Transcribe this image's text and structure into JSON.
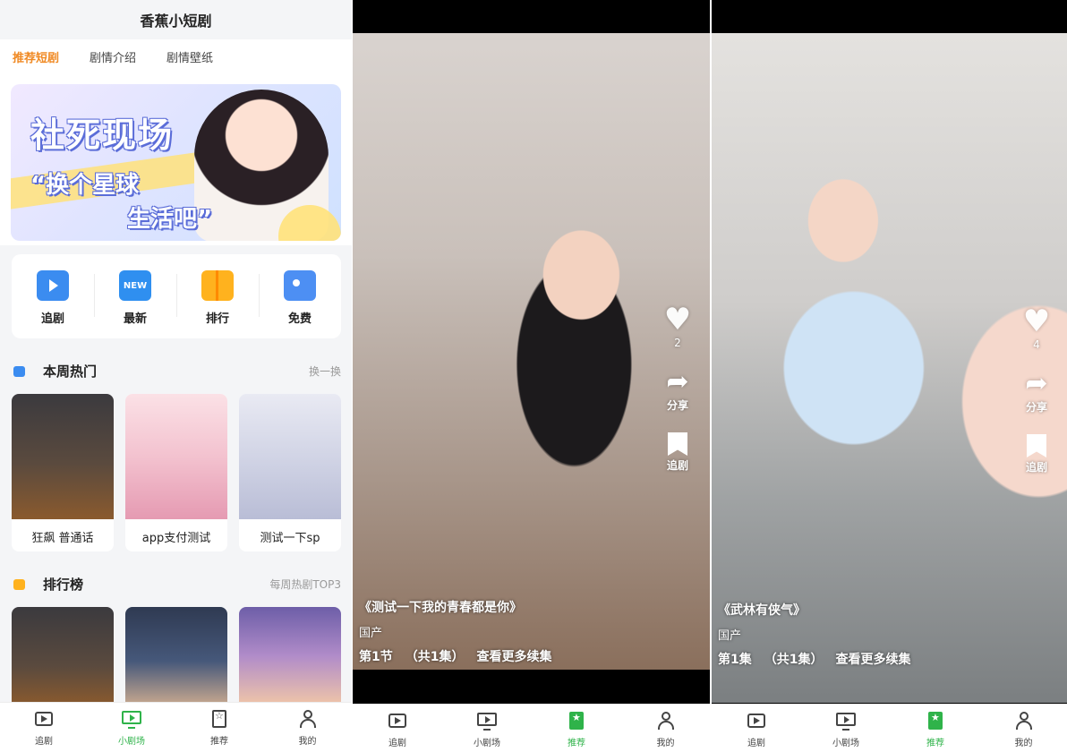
{
  "home": {
    "title": "香蕉小短剧",
    "tabs": [
      "推荐短剧",
      "剧情介绍",
      "剧情壁纸"
    ],
    "banner": {
      "line1": "社死现场",
      "line2": "“换个星球",
      "line3": "生活吧”"
    },
    "quick": [
      "追剧",
      "最新",
      "排行",
      "免费"
    ],
    "hot": {
      "title": "本周热门",
      "more": "换一换",
      "items": [
        "狂飙 普通话",
        "app支付测试",
        "测试一下sp"
      ]
    },
    "rank": {
      "title": "排行榜",
      "more": "每周热剧TOP3"
    }
  },
  "nav_home": [
    "追剧",
    "小剧场",
    "推荐",
    "我的"
  ],
  "nav_video": [
    "追剧",
    "小剧场",
    "推荐",
    "我的"
  ],
  "video1": {
    "likes": "2",
    "share": "分享",
    "follow": "追剧",
    "title": "《测试一下我的青春都是你》",
    "tag": "国产",
    "episode": "第1节",
    "total": "（共1集）",
    "more": "查看更多续集"
  },
  "video2": {
    "likes": "4",
    "share": "分享",
    "follow": "追剧",
    "title": "《武林有侠气》",
    "tag": "国产",
    "episode": "第1集",
    "total": "（共1集）",
    "more": "查看更多续集"
  },
  "colors": {
    "accent_orange": "#f08a24",
    "nav_active_green": "#2fb34a"
  },
  "icons": [
    "follow-icon",
    "new-icon",
    "rank-icon",
    "free-icon",
    "heart-icon",
    "share-icon",
    "bookmark-icon",
    "play-square-icon",
    "tv-icon",
    "star-bookmark-icon",
    "user-icon"
  ]
}
